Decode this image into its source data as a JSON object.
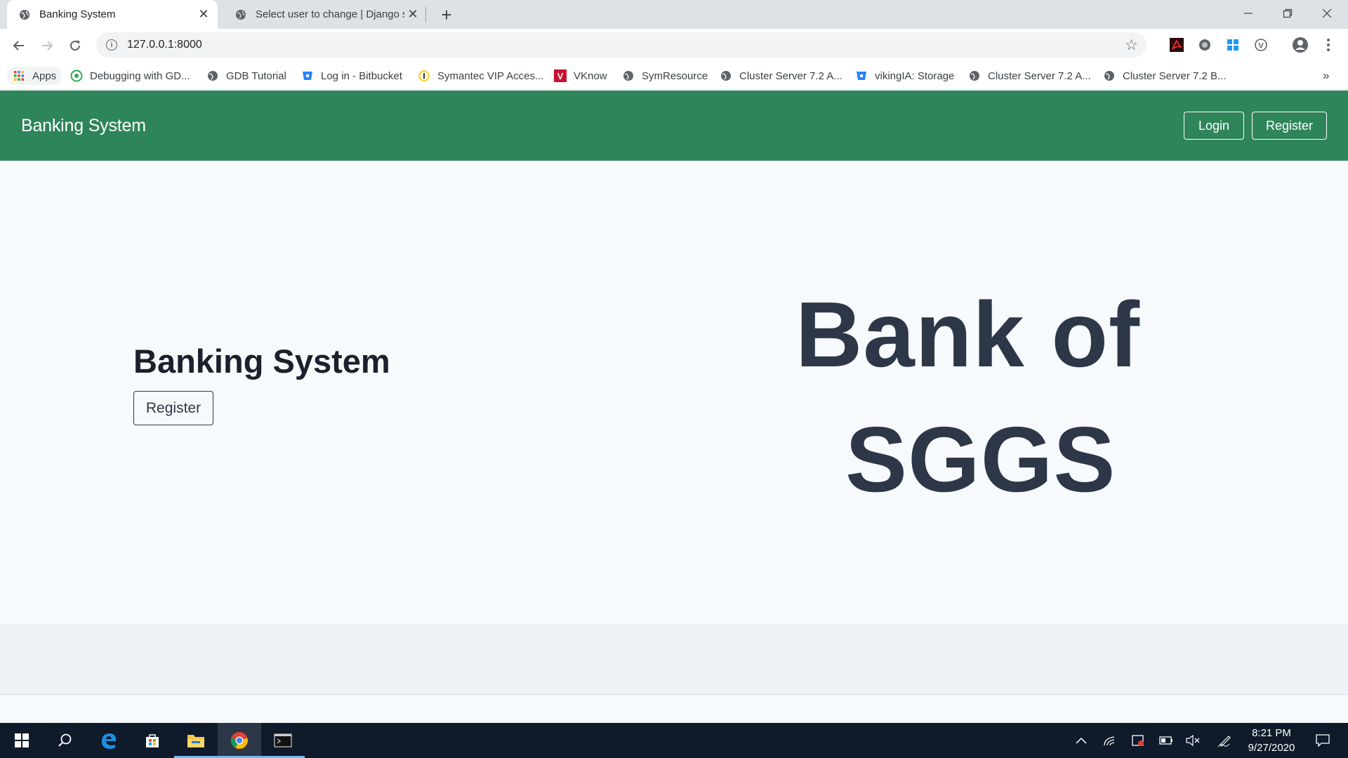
{
  "browser": {
    "tabs": [
      {
        "title": "Banking System",
        "active": true
      },
      {
        "title": "Select user to change | Django si",
        "active": false
      }
    ],
    "address": "127.0.0.1:8000",
    "bookmarks": [
      {
        "label": "Apps",
        "icon": "apps-grid-icon"
      },
      {
        "label": "Debugging with GD...",
        "icon": "green-circle-icon"
      },
      {
        "label": "GDB Tutorial",
        "icon": "globe-icon"
      },
      {
        "label": "Log in - Bitbucket",
        "icon": "bitbucket-icon"
      },
      {
        "label": "Symantec VIP Acces...",
        "icon": "symantec-icon"
      },
      {
        "label": "VKnow",
        "icon": "vknow-icon"
      },
      {
        "label": "SymResource",
        "icon": "globe-icon"
      },
      {
        "label": "Cluster Server 7.2 A...",
        "icon": "globe-icon"
      },
      {
        "label": "vikingIA: Storage",
        "icon": "bitbucket-icon"
      },
      {
        "label": "Cluster Server 7.2 A...",
        "icon": "globe-icon"
      },
      {
        "label": "Cluster Server 7.2 B...",
        "icon": "globe-icon"
      }
    ],
    "more_bookmarks": "»"
  },
  "navbar": {
    "brand": "Banking System",
    "login_label": "Login",
    "register_label": "Register",
    "color": "#2f855a"
  },
  "hero": {
    "title": "Banking System",
    "register_label": "Register",
    "big_line1": "Bank of",
    "big_line2": "SGGS"
  },
  "taskbar": {
    "time": "8:21 PM",
    "date": "9/27/2020"
  }
}
